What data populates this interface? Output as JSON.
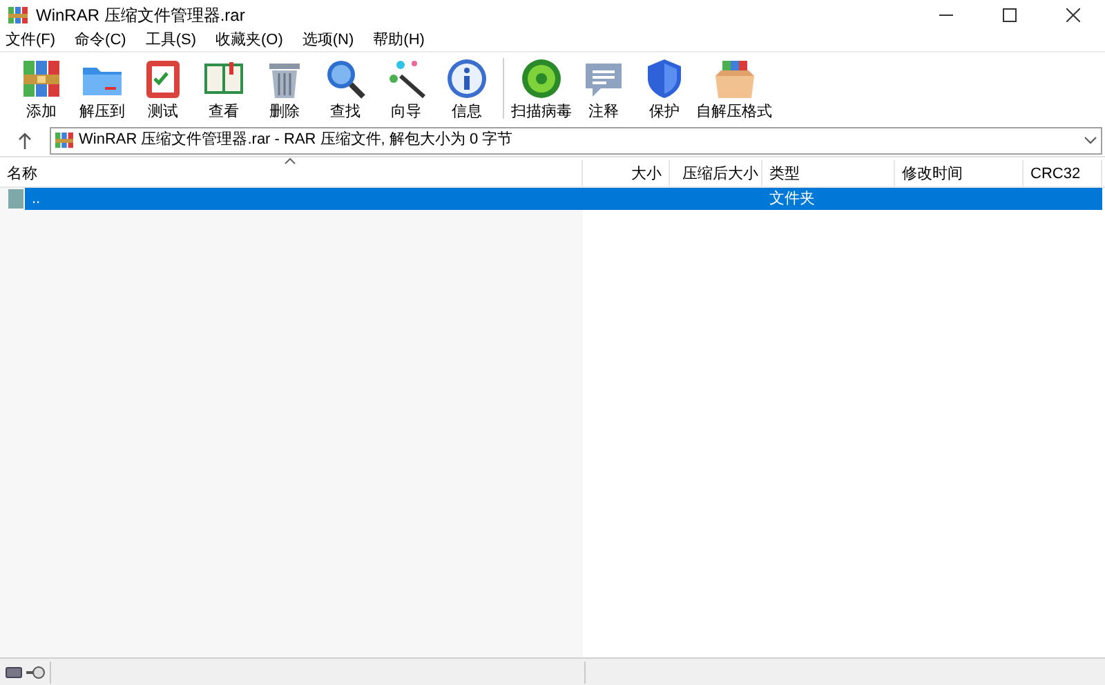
{
  "window": {
    "title": "WinRAR 压缩文件管理器.rar"
  },
  "menu": [
    "文件(F)",
    "命令(C)",
    "工具(S)",
    "收藏夹(O)",
    "选项(N)",
    "帮助(H)"
  ],
  "toolbar": [
    {
      "label": "添加"
    },
    {
      "label": "解压到"
    },
    {
      "label": "测试"
    },
    {
      "label": "查看"
    },
    {
      "label": "删除"
    },
    {
      "label": "查找"
    },
    {
      "label": "向导"
    },
    {
      "label": "信息"
    },
    {
      "label": "扫描病毒"
    },
    {
      "label": "注释"
    },
    {
      "label": "保护"
    },
    {
      "label": "自解压格式"
    }
  ],
  "address": {
    "value": "WinRAR 压缩文件管理器.rar - RAR 压缩文件, 解包大小为 0 字节"
  },
  "table": {
    "columns": [
      "名称",
      "大小",
      "压缩后大小",
      "类型",
      "修改时间",
      "CRC32"
    ],
    "rows": [
      {
        "name": "..",
        "size": "",
        "packed": "",
        "type": "文件夹",
        "modified": "",
        "crc": "",
        "selected": true
      }
    ]
  }
}
